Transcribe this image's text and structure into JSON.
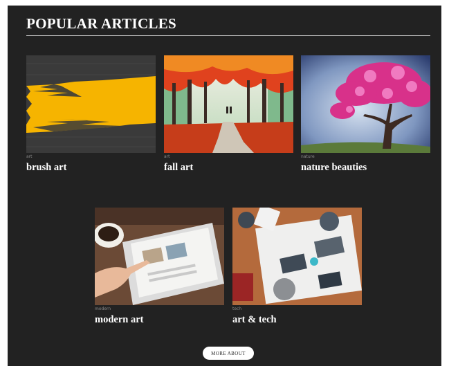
{
  "section": {
    "title": "POPULAR ARTICLES",
    "more_label": "MORE ABOUT"
  },
  "articles": [
    {
      "category": "art",
      "title": "brush art",
      "image": "yellow-brush-stroke-painting"
    },
    {
      "category": "art",
      "title": "fall art",
      "image": "autumn-forest-painting"
    },
    {
      "category": "nature",
      "title": "nature beauties",
      "image": "pink-blossom-tree-painting"
    },
    {
      "category": "modern",
      "title": "modern art",
      "image": "tablet-and-coffee-photo"
    },
    {
      "category": "tech",
      "title": "art & tech",
      "image": "team-laptops-desk-photo"
    }
  ],
  "colors": {
    "panel_bg": "#222222",
    "text": "#ffffff",
    "category_text": "#8a8a8a",
    "rule": "#bdbdbd",
    "button_bg": "#ffffff"
  }
}
